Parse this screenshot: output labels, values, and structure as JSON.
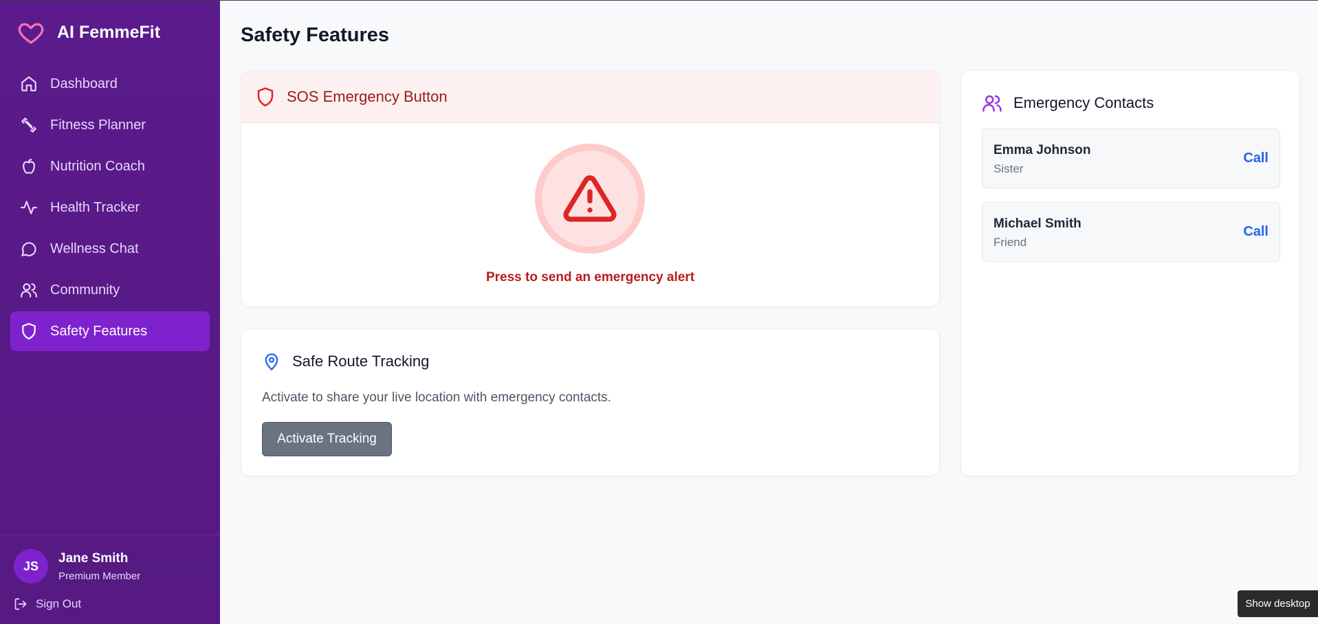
{
  "app": {
    "name": "AI FemmeFit",
    "brand_color": "#ec4899"
  },
  "sidebar": {
    "items": [
      {
        "label": "Dashboard",
        "icon": "home-icon"
      },
      {
        "label": "Fitness Planner",
        "icon": "dumbbell-icon"
      },
      {
        "label": "Nutrition Coach",
        "icon": "apple-icon"
      },
      {
        "label": "Health Tracker",
        "icon": "activity-icon"
      },
      {
        "label": "Wellness Chat",
        "icon": "chat-bubble-icon"
      },
      {
        "label": "Community",
        "icon": "users-icon"
      },
      {
        "label": "Safety Features",
        "icon": "shield-icon",
        "active": true
      }
    ],
    "user": {
      "initials": "JS",
      "name": "Jane Smith",
      "role": "Premium Member"
    },
    "sign_out": "Sign Out"
  },
  "page": {
    "title": "Safety Features"
  },
  "sos": {
    "title": "SOS Emergency Button",
    "caption": "Press to send an emergency alert"
  },
  "route": {
    "title": "Safe Route Tracking",
    "description": "Activate to share your live location with emergency contacts.",
    "button": "Activate Tracking"
  },
  "contacts": {
    "title": "Emergency Contacts",
    "items": [
      {
        "name": "Emma Johnson",
        "relation": "Sister",
        "action": "Call"
      },
      {
        "name": "Michael Smith",
        "relation": "Friend",
        "action": "Call"
      }
    ]
  },
  "taskbar": {
    "show_desktop": "Show desktop"
  }
}
